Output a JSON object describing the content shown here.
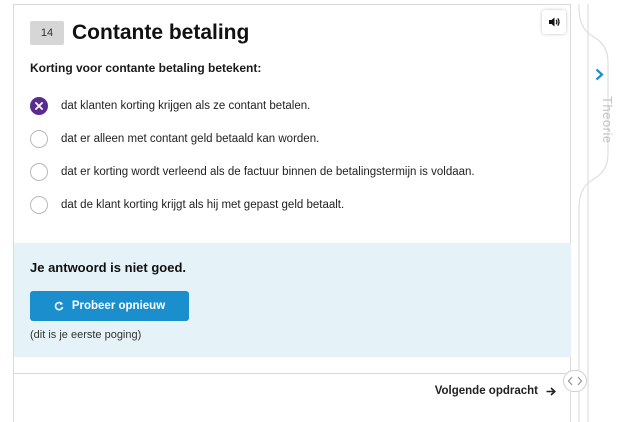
{
  "question": {
    "number": "14",
    "title": "Contante betaling",
    "prompt": "Korting voor contante betaling betekent:",
    "options": [
      {
        "label": "dat klanten korting krijgen als ze contant betalen.",
        "state": "selected-wrong"
      },
      {
        "label": "dat er alleen met contant geld betaald kan worden.",
        "state": "unselected"
      },
      {
        "label": "dat er korting wordt verleend als de factuur binnen de betalingstermijn is voldaan.",
        "state": "unselected"
      },
      {
        "label": "dat de klant korting krijgt als hij met gepast geld betaalt.",
        "state": "unselected"
      }
    ]
  },
  "feedback": {
    "message": "Je antwoord is niet goed.",
    "retry_label": "Probeer opnieuw",
    "attempt_note": "(dit is je eerste poging)"
  },
  "footer": {
    "next_label": "Volgende opdracht"
  },
  "sidebar": {
    "label": "Theorie"
  },
  "colors": {
    "wrong": "#5b2c8f",
    "button": "#1b8fcd",
    "feedback_bg": "#e5f3f8"
  },
  "icons": [
    "speaker-icon",
    "wrong-x-icon",
    "refresh-icon",
    "arrow-right-icon",
    "chevron-right-icon",
    "collapse-arrows-icon"
  ]
}
